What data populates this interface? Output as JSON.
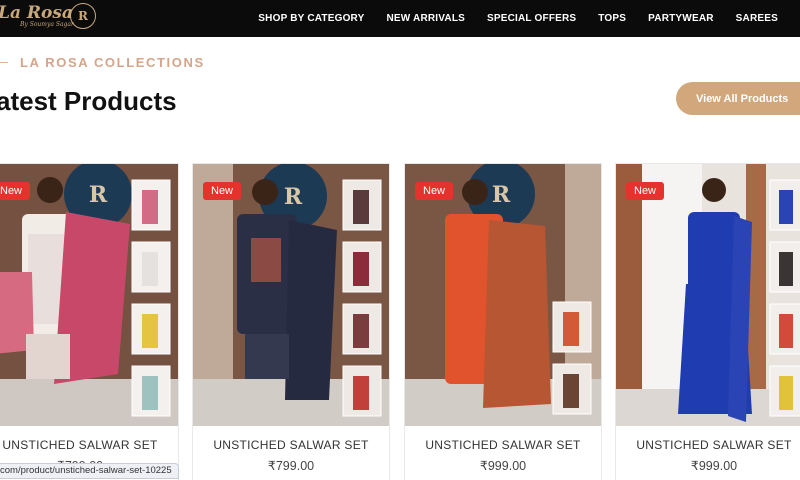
{
  "header": {
    "logo_text": "La Rosa",
    "logo_sub": "By Soumya Sagar",
    "logo_badge": "R",
    "nav": [
      "SHOP BY CATEGORY",
      "NEW ARRIVALS",
      "SPECIAL OFFERS",
      "TOPS",
      "PARTYWEAR",
      "SAREES"
    ]
  },
  "section": {
    "eyebrow": "LA ROSA COLLECTIONS",
    "title": "atest Products",
    "view_all": "View All Products"
  },
  "products": [
    {
      "badge": "New",
      "name": "UNSTICHED SALWAR SET",
      "price": "₹799.00"
    },
    {
      "badge": "New",
      "name": "UNSTICHED SALWAR SET",
      "price": "₹799.00"
    },
    {
      "badge": "New",
      "name": "UNSTICHED SALWAR SET",
      "price": "₹999.00"
    },
    {
      "badge": "New",
      "name": "UNSTICHED SALWAR SET",
      "price": "₹999.00"
    }
  ],
  "status_url": "com/product/unstiched-salwar-set-10225",
  "colors": {
    "topbar": "#0b0b0b",
    "accent": "#d2a77c",
    "badge": "#e5322d"
  }
}
